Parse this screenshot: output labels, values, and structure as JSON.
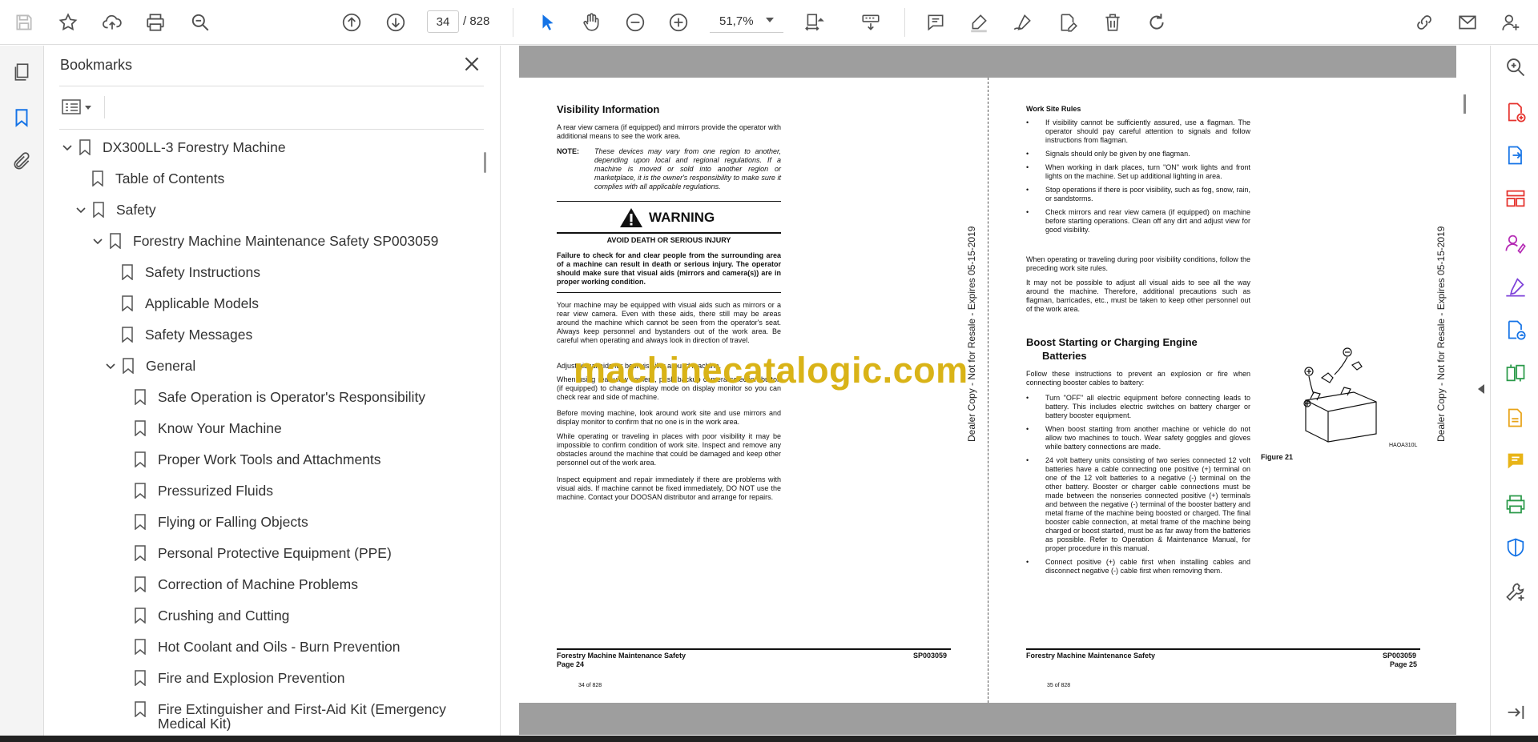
{
  "toolbar": {
    "page_current": "34",
    "page_total": "/  828",
    "zoom": "51,7%"
  },
  "bookmarks": {
    "title": "Bookmarks",
    "items": [
      {
        "label": "DX300LL-3 Forestry Machine",
        "expanded": true
      },
      {
        "label": "Table of Contents"
      },
      {
        "label": "Safety",
        "expanded": true
      },
      {
        "label": "Forestry Machine Maintenance Safety SP003059",
        "expanded": true
      },
      {
        "label": "Safety Instructions"
      },
      {
        "label": "Applicable Models"
      },
      {
        "label": "Safety Messages"
      },
      {
        "label": "General",
        "expanded": true
      },
      {
        "label": "Safe Operation is Operator's Responsibility"
      },
      {
        "label": "Know Your Machine"
      },
      {
        "label": "Proper Work Tools and Attachments"
      },
      {
        "label": "Pressurized Fluids"
      },
      {
        "label": "Flying or Falling Objects"
      },
      {
        "label": "Personal Protective Equipment (PPE)"
      },
      {
        "label": "Correction of Machine Problems"
      },
      {
        "label": "Crushing and Cutting"
      },
      {
        "label": "Hot Coolant and Oils - Burn Prevention"
      },
      {
        "label": "Fire and Explosion Prevention"
      },
      {
        "label": "Fire Extinguisher and First-Aid Kit (Emergency"
      },
      {
        "label": "Medical Kit)"
      }
    ]
  },
  "left_page": {
    "heading": "Visibility Information",
    "intro": "A rear view camera (if equipped) and mirrors provide the operator with additional means to see the work area.",
    "note_label": "NOTE:",
    "note_text": "These devices may vary from one region to another, depending upon local and regional regulations. If a machine is moved or sold into another region or marketplace, it is the owner's responsibility to make sure it complies with all applicable regulations.",
    "warning_title": "WARNING",
    "warning_sub": "AVOID DEATH OR SERIOUS INJURY",
    "warning_body": "Failure to check for and clear people from the surrounding area of a machine can result in death or serious injury. The operator should make sure that visual aids (mirrors and camera(s)) are in proper working condition.",
    "p1": "Your machine may be equipped with visual aids such as mirrors or a rear view camera. Even with these aids, there still may be areas around the machine which cannot be seen from the operator's seat. Always keep personnel and bystanders out of the work area. Be careful when operating and always look in direction of travel.",
    "p2": "Adjust visual aids for best visibility around machine.",
    "p3": "When using rear view camera, push backup camera selection button (if equipped) to change display mode on display monitor so you can check rear and side of machine.",
    "p4": "Before moving machine, look around work site and use mirrors and display monitor to confirm that no one is in the work area.",
    "p5": "While operating or traveling in places with poor visibility it may be impossible to confirm condition of work site. Inspect and remove any obstacles around the machine that could be damaged and keep other personnel out of the work area.",
    "p6": "Inspect equipment and repair immediately if there are problems with visual aids. If machine cannot be fixed immediately, DO NOT use the machine. Contact your DOOSAN distributor and arrange for repairs.",
    "footer_left": "Forestry Machine Maintenance Safety",
    "footer_page": "Page 24",
    "footer_code": "SP003059",
    "page_of": "34 of 828",
    "vertical": "Dealer Copy - Not for Resale - Expires 05-15-2019"
  },
  "right_page": {
    "heading": "Work Site Rules",
    "bullets": [
      "If visibility cannot be sufficiently assured, use a flagman. The operator should pay careful attention to signals and follow instructions from flagman.",
      "Signals should only be given by one flagman.",
      "When working in dark places, turn \"ON\" work lights and front lights on the machine. Set up additional lighting in area.",
      "Stop operations if there is poor visibility, such as fog, snow, rain, or sandstorms.",
      "Check mirrors and rear view camera (if equipped) on machine before starting operations. Clean off any dirt and adjust view for good visibility."
    ],
    "p1": "When operating or traveling during poor visibility conditions, follow the preceding work site rules.",
    "p2": "It may not be possible to adjust all visual aids to see all the way around the machine. Therefore, additional precautions such as flagman, barricades, etc., must be taken to keep other personnel out of the work area.",
    "heading2_line1": "Boost Starting or Charging Engine",
    "heading2_line2": "Batteries",
    "p3": "Follow these instructions to prevent an explosion or fire when connecting booster cables to battery:",
    "bullets2": [
      "Turn \"OFF\" all electric equipment before connecting leads to battery. This includes electric switches on battery charger or battery booster equipment.",
      "When boost starting from another machine or vehicle do not allow two machines to touch. Wear safety goggles and gloves while battery connections are made.",
      "24 volt battery units consisting of two series connected 12 volt batteries have a cable connecting one positive (+) terminal on one of the 12 volt batteries to a negative (-) terminal on the other battery. Booster or charger cable connections must be made between the nonseries connected positive (+) terminals and between the negative (-) terminal of the booster battery and metal frame of the machine being boosted or charged. The final booster cable connection, at metal frame of the machine being charged or boost started, must be as far away from the batteries as possible. Refer to Operation & Maintenance Manual, for proper procedure in this manual.",
      "Connect positive (+) cable first when installing cables and disconnect negative (-) cable first when removing them."
    ],
    "figure_label": "Figure 21",
    "figure_code": "HAOA310L",
    "footer_left": "Forestry Machine Maintenance Safety",
    "footer_code": "SP003059",
    "footer_page": "Page 25",
    "page_of": "35 of 828",
    "vertical": "Dealer Copy - Not for Resale - Expires 05-15-2019"
  },
  "watermark": "machinecatalogic.com",
  "colors": {
    "accent": "#1473e6",
    "watermark": "#d9b317",
    "gutter": "#9e9e9e"
  }
}
